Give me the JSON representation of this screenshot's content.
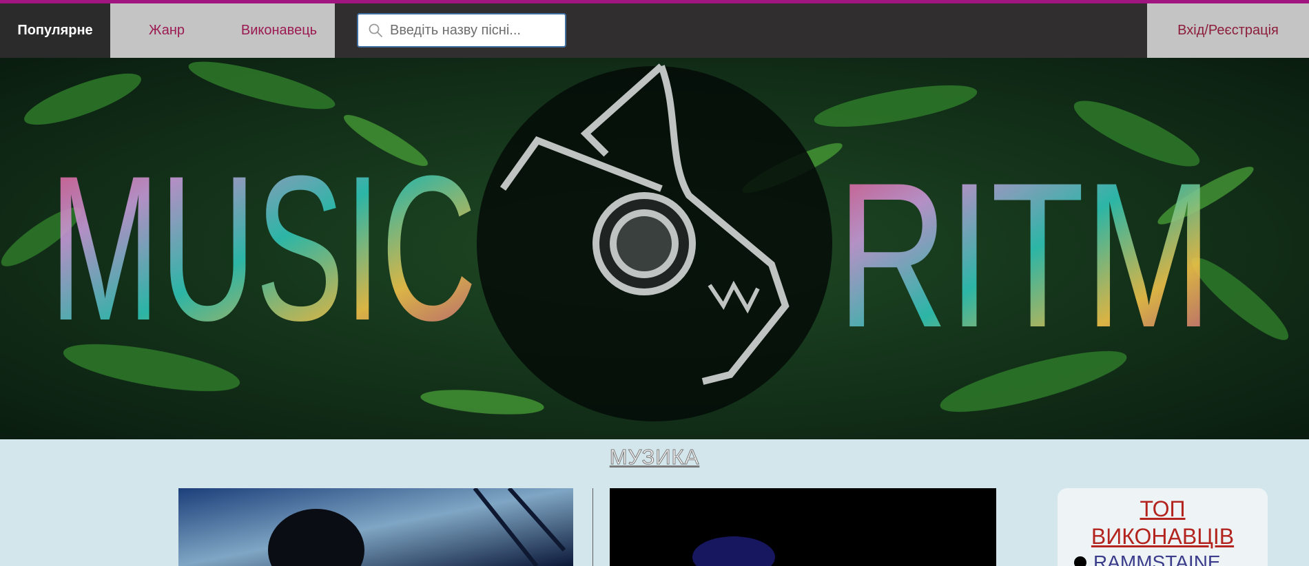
{
  "colors": {
    "accent": "#a0157f",
    "nav_bg": "#312e30",
    "nav_link": "#9b1a52",
    "page_bg": "#d3e6ec",
    "top_title": "#b3241e"
  },
  "nav": {
    "popular": "Популярне",
    "genre": "Жанр",
    "artist": "Виконавець",
    "login": "Вхід/Реєстрація"
  },
  "search": {
    "placeholder": "Введіть назву пісні...",
    "icon": "search-icon"
  },
  "hero": {
    "left_word": "MUSIC",
    "right_word": "RITM",
    "logo": "wolf-headphones-logo"
  },
  "section": {
    "title": "МУЗИКА"
  },
  "top_artists": {
    "title_line1": "ТОП",
    "title_line2": "ВИКОНАВЦІВ",
    "items": [
      "RAMMSTAINE"
    ]
  }
}
